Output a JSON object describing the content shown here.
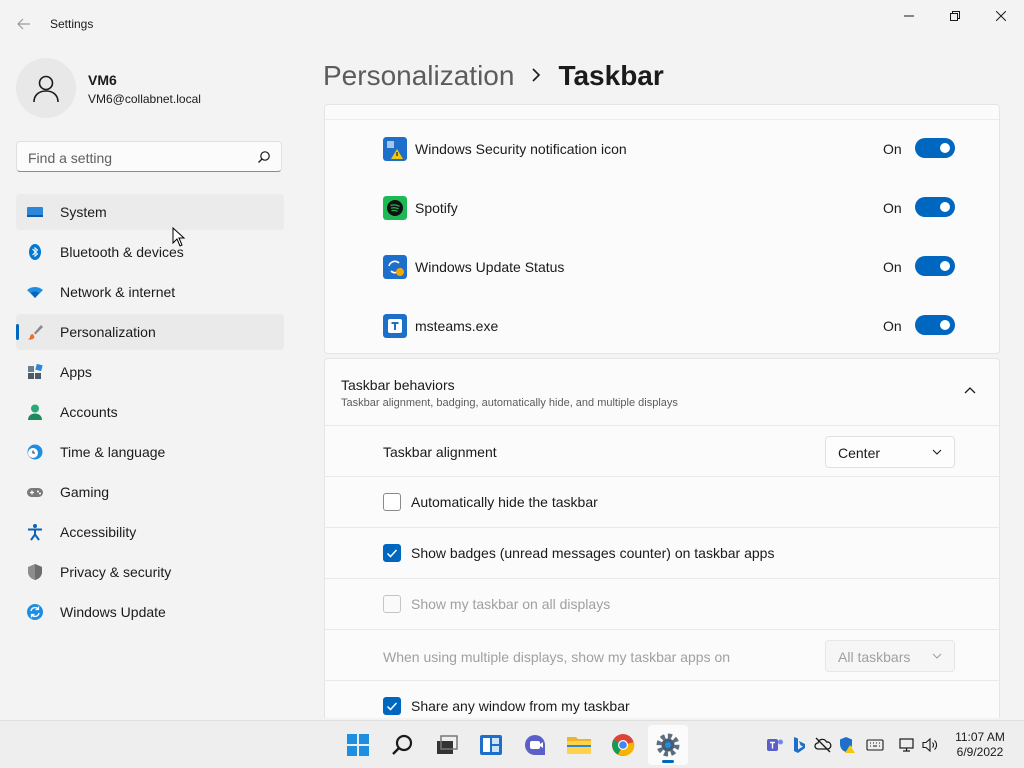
{
  "window": {
    "title": "Settings"
  },
  "user": {
    "name": "VM6",
    "email": "VM6@collabnet.local"
  },
  "search": {
    "placeholder": "Find a setting"
  },
  "nav": [
    {
      "label": "System",
      "icon": "system-icon"
    },
    {
      "label": "Bluetooth & devices",
      "icon": "bluetooth-icon"
    },
    {
      "label": "Network & internet",
      "icon": "wifi-icon"
    },
    {
      "label": "Personalization",
      "icon": "brush-icon"
    },
    {
      "label": "Apps",
      "icon": "apps-icon"
    },
    {
      "label": "Accounts",
      "icon": "person-icon"
    },
    {
      "label": "Time & language",
      "icon": "clock-globe-icon"
    },
    {
      "label": "Gaming",
      "icon": "gamepad-icon"
    },
    {
      "label": "Accessibility",
      "icon": "accessibility-icon"
    },
    {
      "label": "Privacy & security",
      "icon": "shield-icon"
    },
    {
      "label": "Windows Update",
      "icon": "update-icon"
    }
  ],
  "breadcrumb": {
    "parent": "Personalization",
    "current": "Taskbar"
  },
  "tray_apps": [
    {
      "label": "Windows Security notification icon",
      "state": "On",
      "on": true
    },
    {
      "label": "Spotify",
      "state": "On",
      "on": true
    },
    {
      "label": "Windows Update Status",
      "state": "On",
      "on": true
    },
    {
      "label": "msteams.exe",
      "state": "On",
      "on": true
    }
  ],
  "behaviors": {
    "title": "Taskbar behaviors",
    "subtitle": "Taskbar alignment, badging, automatically hide, and multiple displays",
    "alignment_label": "Taskbar alignment",
    "alignment_value": "Center",
    "auto_hide": {
      "label": "Automatically hide the taskbar",
      "checked": false
    },
    "badges": {
      "label": "Show badges (unread messages counter) on taskbar apps",
      "checked": true
    },
    "all_displays": {
      "label": "Show my taskbar on all displays",
      "checked": false,
      "disabled": true
    },
    "multi_display_label": "When using multiple displays, show my taskbar apps on",
    "multi_display_value": "All taskbars",
    "share_window": {
      "label": "Share any window from my taskbar",
      "checked": true
    }
  },
  "clock": {
    "time": "11:07 AM",
    "date": "6/9/2022"
  },
  "colors": {
    "accent": "#0067c0",
    "background": "#f3f3f3",
    "card": "#fbfbfb"
  }
}
